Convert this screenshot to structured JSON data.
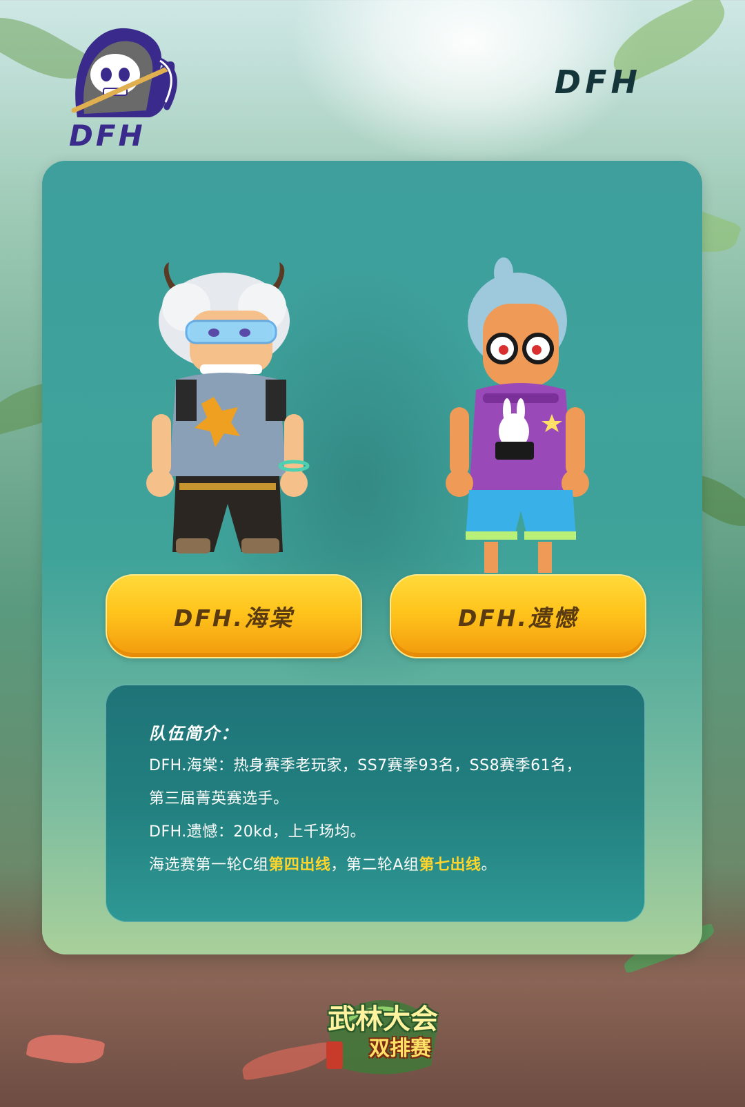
{
  "header": {
    "logo_text": "DFH",
    "team_name": "DFH"
  },
  "players": [
    {
      "name": "DFH.海棠"
    },
    {
      "name": "DFH.遗憾"
    }
  ],
  "intro": {
    "heading": "队伍简介：",
    "line1": "DFH.海棠：热身赛季老玩家，SS7赛季93名，SS8赛季61名，",
    "line2": "第三届菁英赛选手。",
    "line3": "DFH.遗憾：20kd，上千场均。",
    "line4_a": "海选赛第一轮C组",
    "line4_b": "第四出线",
    "line4_c": "，第二轮A组",
    "line4_d": "第七出线",
    "line4_e": "。"
  },
  "event": {
    "title_line1": "武林大会",
    "title_line2": "双排赛"
  },
  "colors": {
    "card_teal": "#3fa39a",
    "button_yellow": "#ffc41c",
    "highlight": "#ffd52b",
    "logo_purple": "#3a2a8c"
  }
}
